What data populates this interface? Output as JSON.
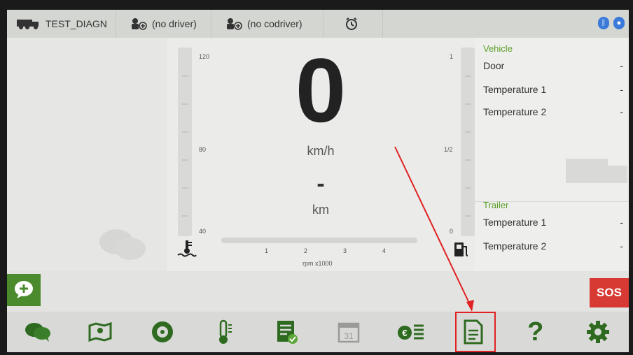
{
  "topbar": {
    "vehicle": "TEST_DIAGN",
    "driver": "(no driver)",
    "codriver": "(no codriver)",
    "icons": [
      "truck-icon",
      "driver-add-icon",
      "codriver-add-icon",
      "alarm-clock-icon",
      "bluetooth-icon",
      "location-icon"
    ]
  },
  "gauge": {
    "speed": "0",
    "speed_unit": "km/h",
    "distance": "-",
    "distance_unit": "km",
    "temp_scale": [
      "120",
      "80",
      "40"
    ],
    "fuel_scale": [
      "1",
      "1/2",
      "0"
    ],
    "rpm_ticks": [
      "1",
      "2",
      "3",
      "4"
    ],
    "rpm_label": "rpm x1000"
  },
  "vehicle": {
    "title": "Vehicle",
    "rows": [
      {
        "label": "Door",
        "value": "-"
      },
      {
        "label": "Temperature 1",
        "value": "-"
      },
      {
        "label": "Temperature 2",
        "value": "-"
      }
    ]
  },
  "trailer": {
    "title": "Trailer",
    "rows": [
      {
        "label": "Temperature 1",
        "value": "-"
      },
      {
        "label": "Temperature 2",
        "value": "-"
      }
    ]
  },
  "actions": {
    "sos_label": "SOS",
    "calendar_day": "31",
    "help_label": "?"
  },
  "nav_items": [
    "messages-icon",
    "map-icon",
    "tire-icon",
    "thermometer-icon",
    "checklist-icon",
    "calendar-icon",
    "expenses-icon",
    "document-icon",
    "help-icon",
    "settings-icon"
  ],
  "colors": {
    "accent": "#4c8a2e",
    "sos": "#d63a32",
    "highlight": "#e02222"
  }
}
